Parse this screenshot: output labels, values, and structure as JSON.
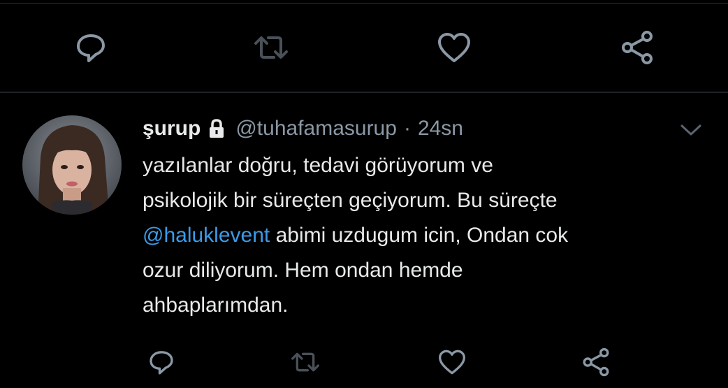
{
  "previous_tweet_actions": {
    "reply_icon": "reply-icon",
    "retweet_icon": "retweet-icon",
    "like_icon": "heart-icon",
    "share_icon": "share-icon"
  },
  "tweet": {
    "display_name": "şurup",
    "protected_icon": "lock-icon",
    "handle": "@tuhafamasurup",
    "separator": "·",
    "timestamp": "24sn",
    "menu_icon": "chevron-down-icon",
    "text_lines": [
      {
        "text": "yazılanlar doğru, tedavi görüyorum ve"
      },
      {
        "text": "psikolojik bir süreçten geçiyorum. Bu süreçte"
      },
      {
        "mention": "@haluklevent",
        "rest": " abimi uzdugum icin, Ondan cok"
      },
      {
        "text": "ozur diliyorum. Hem ondan hemde"
      },
      {
        "text": "ahbaplarımdan."
      }
    ]
  },
  "colors": {
    "background": "#000000",
    "text": "#e7e9ea",
    "secondary_text": "#8b98a5",
    "mention": "#3b9be8",
    "divider": "#1f2326"
  }
}
